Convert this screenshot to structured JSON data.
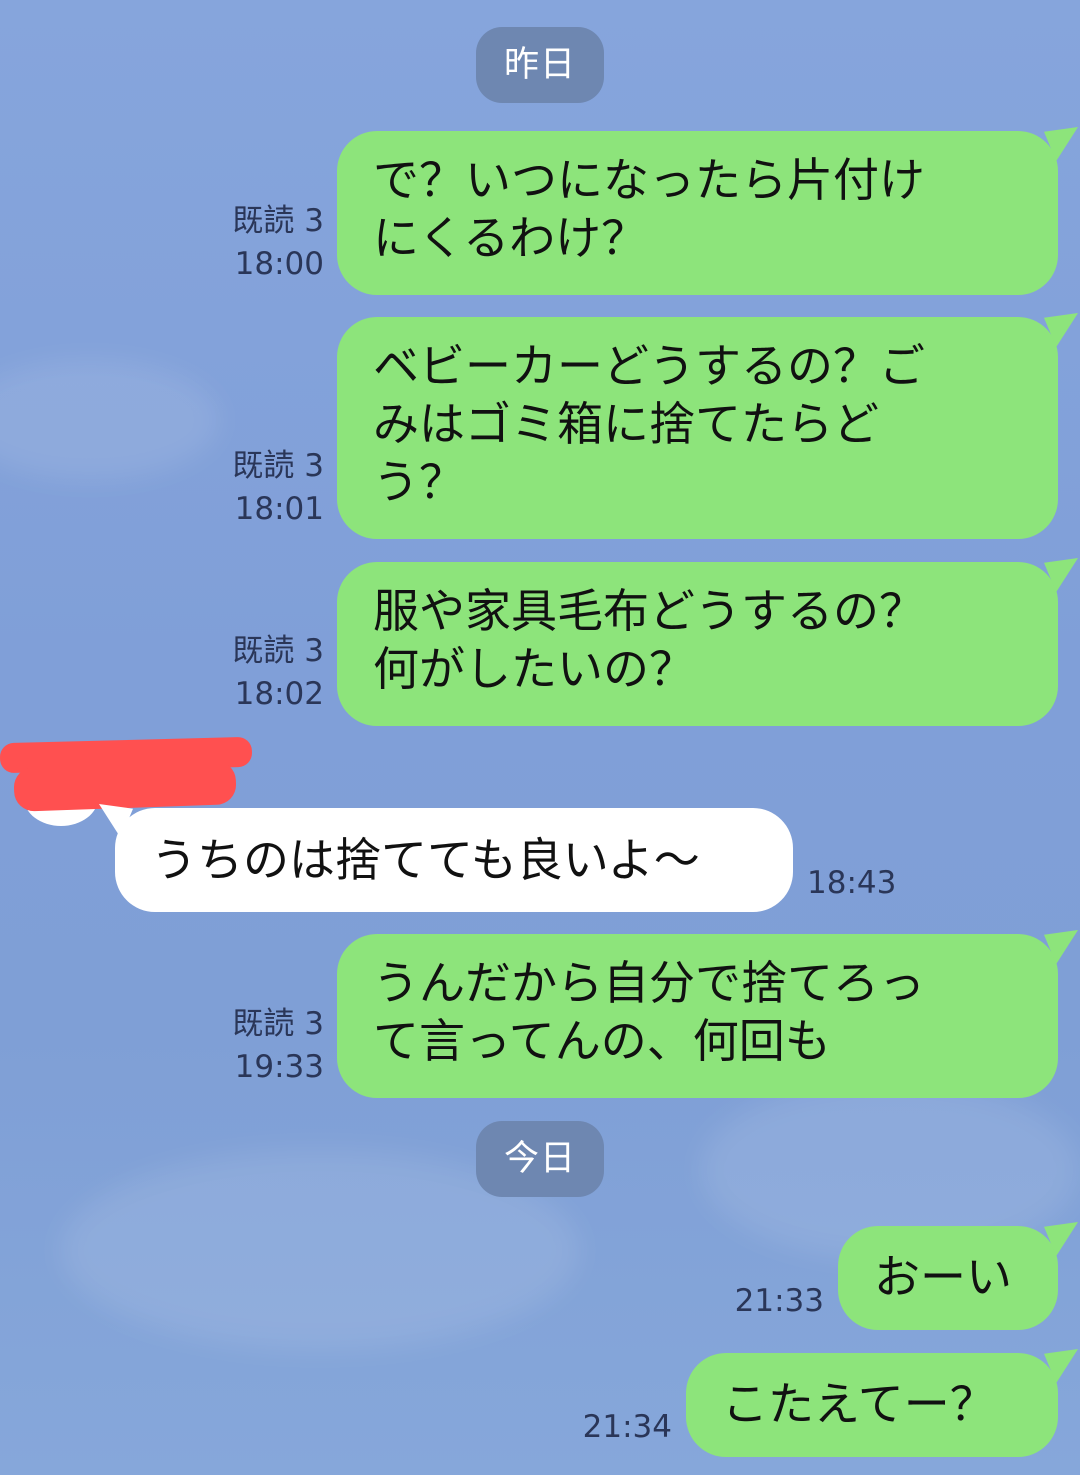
{
  "date_separators": [
    {
      "label": "昨日"
    },
    {
      "label": "今日"
    }
  ],
  "messages": [
    {
      "direction": "sent",
      "text": "で？いつになったら片付け\nにくるわけ？",
      "read_label": "既読 3",
      "time": "18:00"
    },
    {
      "direction": "sent",
      "text": "ベビーカーどうするの？ご\nみはゴミ箱に捨てたらど\nう？",
      "read_label": "既読 3",
      "time": "18:01"
    },
    {
      "direction": "sent",
      "text": "服や家具毛布どうするの？\n何がしたいの？",
      "read_label": "既読 3",
      "time": "18:02"
    },
    {
      "direction": "received",
      "text": "うちのは捨てても良いよ～",
      "time": "18:43"
    },
    {
      "direction": "sent",
      "text": "うんだから自分で捨てろっ\nて言ってんの、何回も",
      "read_label": "既読 3",
      "time": "19:33"
    },
    {
      "direction": "sent",
      "text": "おーい",
      "time": "21:33"
    },
    {
      "direction": "sent",
      "text": "こたえてー？",
      "time": "21:34"
    }
  ],
  "colors": {
    "background": "#809fd8",
    "sent_bubble": "#8de47b",
    "received_bubble": "#ffffff",
    "date_pill": "#6e87b1",
    "redaction": "#ff5050"
  }
}
